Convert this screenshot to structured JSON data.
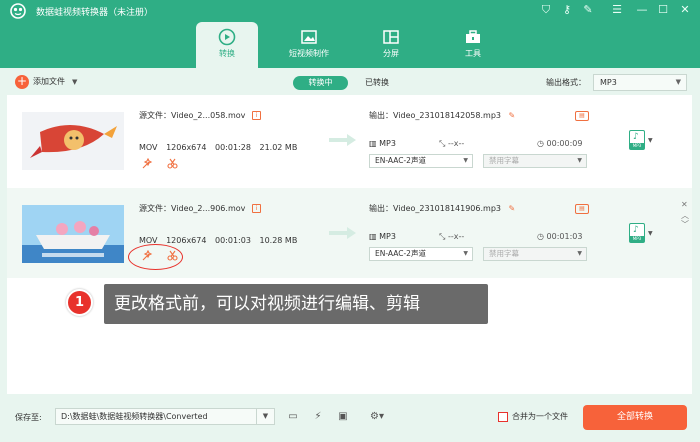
{
  "app": {
    "title": "数据蛙视频转换器（未注册）"
  },
  "window_controls": [
    "cart-icon",
    "key-icon",
    "wrench-icon",
    "menu-icon",
    "minimize-icon",
    "maximize-icon",
    "close-icon"
  ],
  "tabs": [
    {
      "label": "转换",
      "icon": "convert-icon",
      "active": true
    },
    {
      "label": "短视频制作",
      "icon": "shortvideo-icon",
      "active": false
    },
    {
      "label": "分屏",
      "icon": "splitscreen-icon",
      "active": false
    },
    {
      "label": "工具",
      "icon": "toolbox-icon",
      "active": false
    }
  ],
  "toolbar": {
    "add_file": "添加文件",
    "converting": "转换中",
    "converted": "已转换",
    "output_format_label": "输出格式：",
    "output_format_value": "MP3"
  },
  "files": [
    {
      "source": "源文件：Video_2...058.mov",
      "format": "MOV",
      "resolution": "1206x674",
      "duration": "00:01:28",
      "size": "21.02 MB",
      "output": "输出：Video_231018142058.mp3",
      "out_format": "MP3",
      "out_res": "--x--",
      "out_duration": "00:00:09",
      "audio_track": "EN-AAC-2声道",
      "subtitle": "禁用字幕",
      "badge": "MP3"
    },
    {
      "source": "源文件：Video_2...906.mov",
      "format": "MOV",
      "resolution": "1206x674",
      "duration": "00:01:03",
      "size": "10.28 MB",
      "output": "输出：Video_231018141906.mp3",
      "out_format": "MP3",
      "out_res": "--x--",
      "out_duration": "00:01:03",
      "audio_track": "EN-AAC-2声道",
      "subtitle": "禁用字幕",
      "badge": "MP3"
    }
  ],
  "callout": {
    "number": "1",
    "text": "更改格式前，可以对视频进行编辑、剪辑"
  },
  "footer": {
    "save_to": "保存至:",
    "path": "D:\\数据蛙\\数据蛙视频转换器\\Converted",
    "merge_label": "合并为一个文件",
    "convert_all": "全部转换"
  },
  "colors": {
    "brand": "#2fae85",
    "accent": "#f7623a",
    "callout": "#e8322c"
  }
}
